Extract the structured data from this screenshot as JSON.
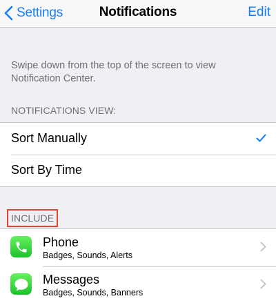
{
  "navbar": {
    "back_label": "Settings",
    "title": "Notifications",
    "edit_label": "Edit"
  },
  "info": {
    "text": "Swipe down from the top of the screen to view Notification Center."
  },
  "notifications_view": {
    "header": "NOTIFICATIONS VIEW:",
    "options": [
      {
        "label": "Sort Manually",
        "selected": true
      },
      {
        "label": "Sort By Time",
        "selected": false
      }
    ]
  },
  "include": {
    "header": "INCLUDE",
    "apps": [
      {
        "name": "Phone",
        "detail": "Badges, Sounds, Alerts",
        "icon": "phone-icon"
      },
      {
        "name": "Messages",
        "detail": "Badges, Sounds, Banners",
        "icon": "messages-icon"
      }
    ]
  },
  "colors": {
    "accent": "#157efb",
    "highlight_border": "#e4452f",
    "app_icon_green": "#1ec22b"
  }
}
